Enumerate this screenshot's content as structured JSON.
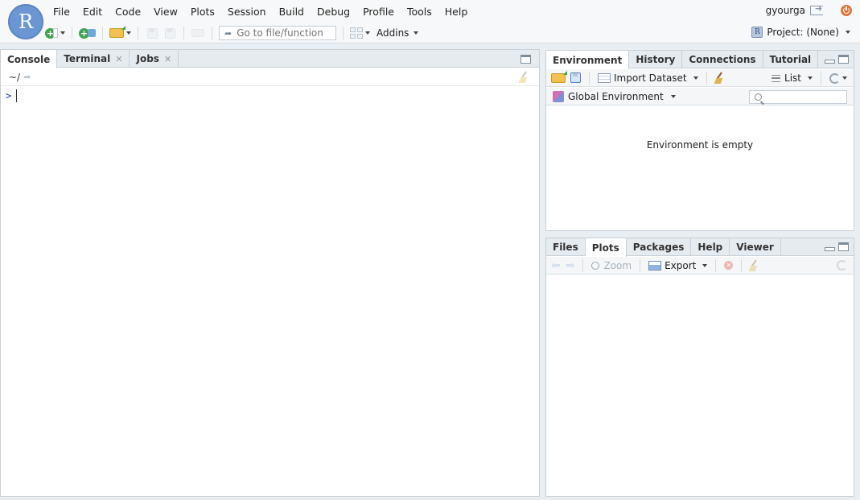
{
  "app": {
    "logo_letter": "R",
    "menu": [
      "File",
      "Edit",
      "Code",
      "View",
      "Plots",
      "Session",
      "Build",
      "Debug",
      "Profile",
      "Tools",
      "Help"
    ],
    "user": "gyourga",
    "goto_placeholder": "Go to file/function",
    "addins_label": "Addins",
    "project_label": "Project: (None)"
  },
  "console_pane": {
    "tabs": [
      {
        "label": "Console",
        "closable": false
      },
      {
        "label": "Terminal",
        "closable": true
      },
      {
        "label": "Jobs",
        "closable": true
      }
    ],
    "path": "~/",
    "prompt": ">"
  },
  "env_pane": {
    "tabs": [
      "Environment",
      "History",
      "Connections",
      "Tutorial"
    ],
    "import_label": "Import Dataset",
    "view_mode": "List",
    "scope": "Global Environment",
    "search_placeholder": "",
    "empty_message": "Environment is empty"
  },
  "files_pane": {
    "tabs": [
      "Files",
      "Plots",
      "Packages",
      "Help",
      "Viewer"
    ],
    "zoom_label": "Zoom",
    "export_label": "Export"
  },
  "colors": {
    "logo_blue": "#6a97d3",
    "prompt_blue": "#2433c4",
    "pane_border": "#c8d0d7",
    "tabbar_bg": "#e6ebef"
  }
}
